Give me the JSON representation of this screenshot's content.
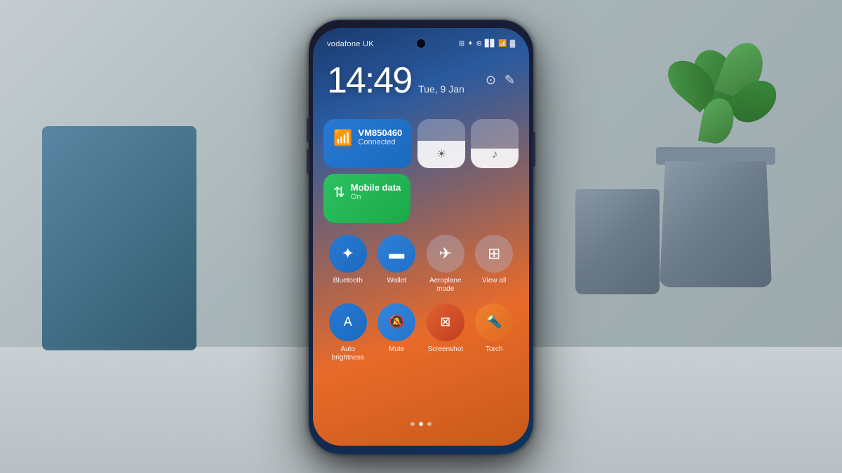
{
  "scene": {
    "background": "#b8c4c8"
  },
  "phone": {
    "carrier": "vodafone UK",
    "time": "14:49",
    "date": "Tue, 9 Jan",
    "status_icons": [
      "⊞",
      "✦",
      "☀",
      "▊▊",
      "📶",
      "🔋"
    ],
    "wifi_tile": {
      "name": "VM850460",
      "status": "Connected",
      "icon": "wifi"
    },
    "mobile_tile": {
      "name": "Mobile data",
      "status": "On",
      "icon": "signal"
    },
    "brightness_icon": "☀",
    "volume_icon": "♪",
    "actions_row1": [
      {
        "label": "Bluetooth",
        "sublabel": ""
      },
      {
        "label": "Wallet",
        "sublabel": ""
      },
      {
        "label": "Aeroplane mode",
        "sublabel": ""
      },
      {
        "label": "View all",
        "sublabel": ""
      }
    ],
    "actions_row2": [
      {
        "label": "Auto brightness",
        "sublabel": ""
      },
      {
        "label": "Mute",
        "sublabel": ""
      },
      {
        "label": "Screenshot",
        "sublabel": ""
      },
      {
        "label": "Torch",
        "sublabel": ""
      }
    ],
    "dots": [
      false,
      true,
      false
    ]
  }
}
